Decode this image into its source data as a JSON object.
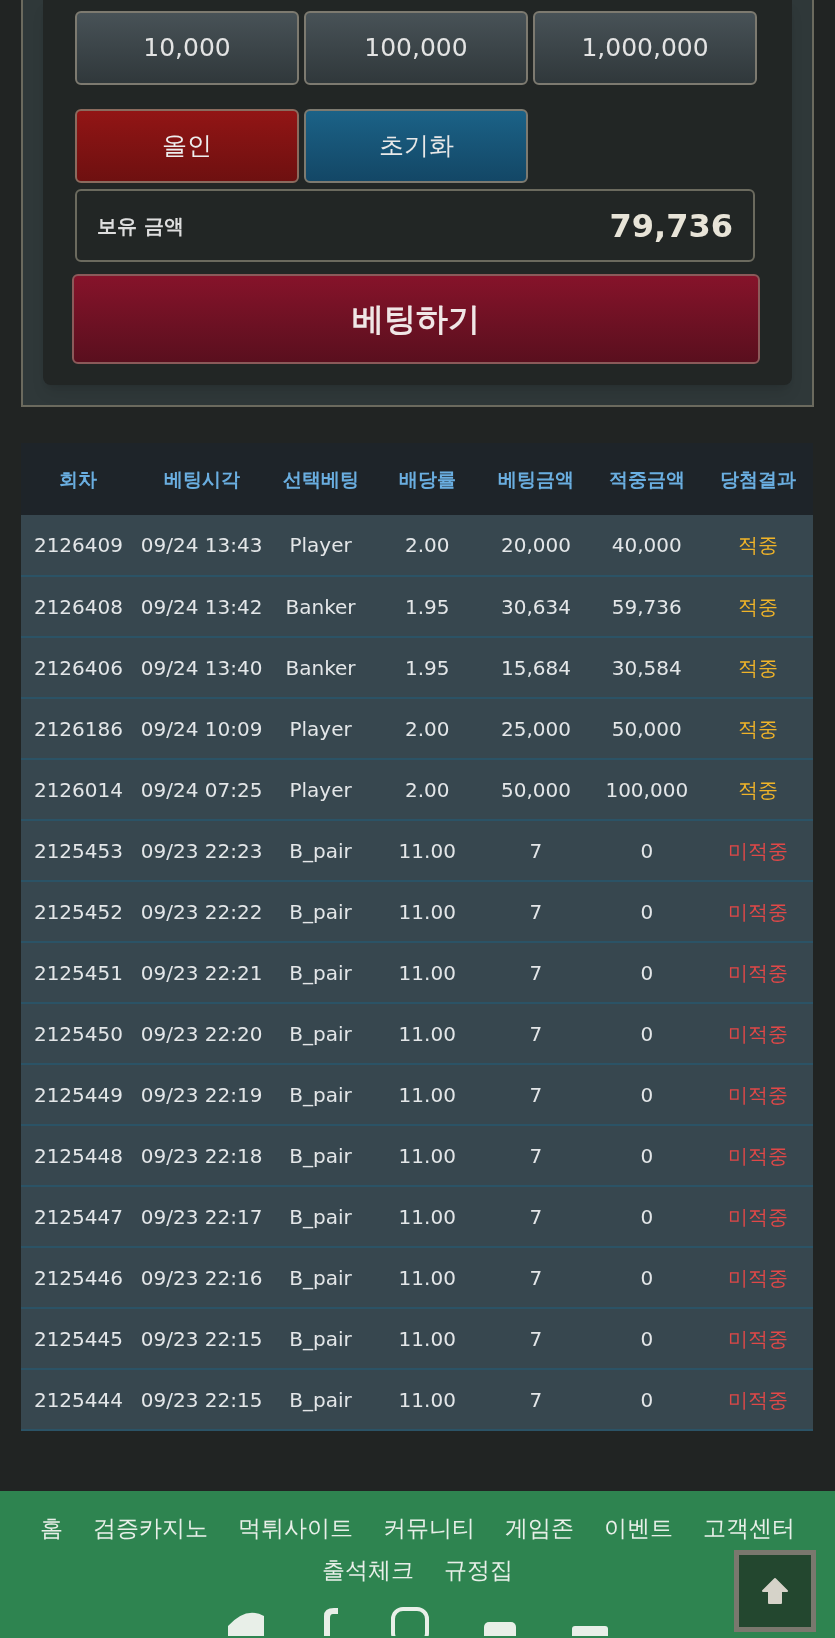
{
  "amount_buttons": [
    "10,000",
    "100,000",
    "1,000,000"
  ],
  "action_buttons": [
    {
      "label": "올인",
      "kind": "allin"
    },
    {
      "label": "초기화",
      "kind": "reset"
    }
  ],
  "balance": {
    "label": "보유 금액",
    "value": "79,736"
  },
  "bet_button": "베팅하기",
  "table": {
    "columns": [
      "회차",
      "베팅시각",
      "선택베팅",
      "배당률",
      "베팅금액",
      "적중금액",
      "당첨결과"
    ],
    "rows": [
      {
        "cells": [
          "2126409",
          "09/24 13:43",
          "Player",
          "2.00",
          "20,000",
          "40,000",
          "적중"
        ],
        "won": true
      },
      {
        "cells": [
          "2126408",
          "09/24 13:42",
          "Banker",
          "1.95",
          "30,634",
          "59,736",
          "적중"
        ],
        "won": true
      },
      {
        "cells": [
          "2126406",
          "09/24 13:40",
          "Banker",
          "1.95",
          "15,684",
          "30,584",
          "적중"
        ],
        "won": true
      },
      {
        "cells": [
          "2126186",
          "09/24 10:09",
          "Player",
          "2.00",
          "25,000",
          "50,000",
          "적중"
        ],
        "won": true
      },
      {
        "cells": [
          "2126014",
          "09/24 07:25",
          "Player",
          "2.00",
          "50,000",
          "100,000",
          "적중"
        ],
        "won": true
      },
      {
        "cells": [
          "2125453",
          "09/23 22:23",
          "B_pair",
          "11.00",
          "7",
          "0",
          "미적중"
        ],
        "won": false
      },
      {
        "cells": [
          "2125452",
          "09/23 22:22",
          "B_pair",
          "11.00",
          "7",
          "0",
          "미적중"
        ],
        "won": false
      },
      {
        "cells": [
          "2125451",
          "09/23 22:21",
          "B_pair",
          "11.00",
          "7",
          "0",
          "미적중"
        ],
        "won": false
      },
      {
        "cells": [
          "2125450",
          "09/23 22:20",
          "B_pair",
          "11.00",
          "7",
          "0",
          "미적중"
        ],
        "won": false
      },
      {
        "cells": [
          "2125449",
          "09/23 22:19",
          "B_pair",
          "11.00",
          "7",
          "0",
          "미적중"
        ],
        "won": false
      },
      {
        "cells": [
          "2125448",
          "09/23 22:18",
          "B_pair",
          "11.00",
          "7",
          "0",
          "미적중"
        ],
        "won": false
      },
      {
        "cells": [
          "2125447",
          "09/23 22:17",
          "B_pair",
          "11.00",
          "7",
          "0",
          "미적중"
        ],
        "won": false
      },
      {
        "cells": [
          "2125446",
          "09/23 22:16",
          "B_pair",
          "11.00",
          "7",
          "0",
          "미적중"
        ],
        "won": false
      },
      {
        "cells": [
          "2125445",
          "09/23 22:15",
          "B_pair",
          "11.00",
          "7",
          "0",
          "미적중"
        ],
        "won": false
      },
      {
        "cells": [
          "2125444",
          "09/23 22:15",
          "B_pair",
          "11.00",
          "7",
          "0",
          "미적중"
        ],
        "won": false
      }
    ]
  },
  "footer": {
    "nav_row_1": [
      "홈",
      "검증카지노",
      "먹튀사이트",
      "커뮤니티",
      "게임존",
      "이벤트",
      "고객센터"
    ],
    "nav_row_2": [
      "출석체크",
      "규정집"
    ]
  }
}
